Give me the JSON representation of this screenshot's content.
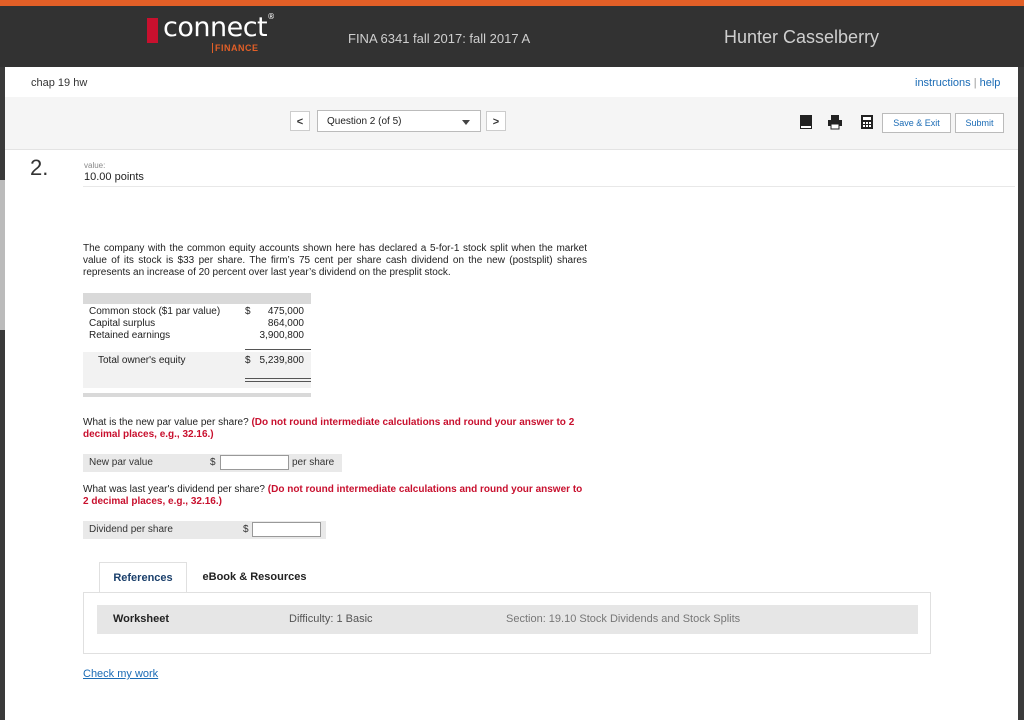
{
  "header": {
    "logo_text": "connect",
    "logo_sub": "FINANCE",
    "course": "FINA 6341 fall 2017: fall 2017 A",
    "user": "Hunter Casselberry",
    "brand_color": "#e25f27"
  },
  "assignment": {
    "title": "chap 19 hw",
    "instructions_link": "instructions",
    "separator": "|",
    "help_link": "help"
  },
  "nav": {
    "prev_label": "<",
    "next_label": ">",
    "question_select": "Question 2 (of 5)",
    "icons": [
      "book-icon",
      "print-icon",
      "calculator-icon"
    ],
    "save_exit_label": "Save & Exit",
    "submit_label": "Submit"
  },
  "question": {
    "number": "2.",
    "value_label": "value:",
    "points": "10.00 points",
    "problem_text": "The company with the common equity accounts shown here has declared a 5-for-1 stock split when the market value of its stock is $33 per share. The firm’s 75 cent per share cash dividend on the new (postsplit) shares represents an increase of 20 percent over last year’s dividend on the presplit stock.",
    "equity_table": {
      "rows": [
        {
          "label": "Common stock ($1 par value)",
          "currency": "$",
          "value": "475,000"
        },
        {
          "label": "Capital surplus",
          "currency": "",
          "value": "864,000"
        },
        {
          "label": "Retained earnings",
          "currency": "",
          "value": "3,900,800"
        }
      ],
      "total": {
        "label": "Total owner's equity",
        "currency": "$",
        "value": "5,239,800"
      }
    },
    "part1": {
      "prompt": "What is the new par value per share?",
      "instruction": "(Do not round intermediate calculations and round your answer to 2 decimal places, e.g., 32.16.)",
      "field_label": "New par value",
      "currency": "$",
      "unit": "per share",
      "value": ""
    },
    "part2": {
      "prompt": "What was last year's dividend per share?",
      "instruction": "(Do not round intermediate calculations and round your answer to 2 decimal places, e.g., 32.16.)",
      "field_label": "Dividend per share",
      "currency": "$",
      "value": ""
    }
  },
  "references": {
    "tabs": [
      "References",
      "eBook & Resources"
    ],
    "active_tab": "References",
    "worksheet_label": "Worksheet",
    "difficulty": "Difficulty: 1 Basic",
    "section": "Section: 19.10 Stock Dividends and Stock Splits"
  },
  "footer": {
    "check_work": "Check my work"
  }
}
